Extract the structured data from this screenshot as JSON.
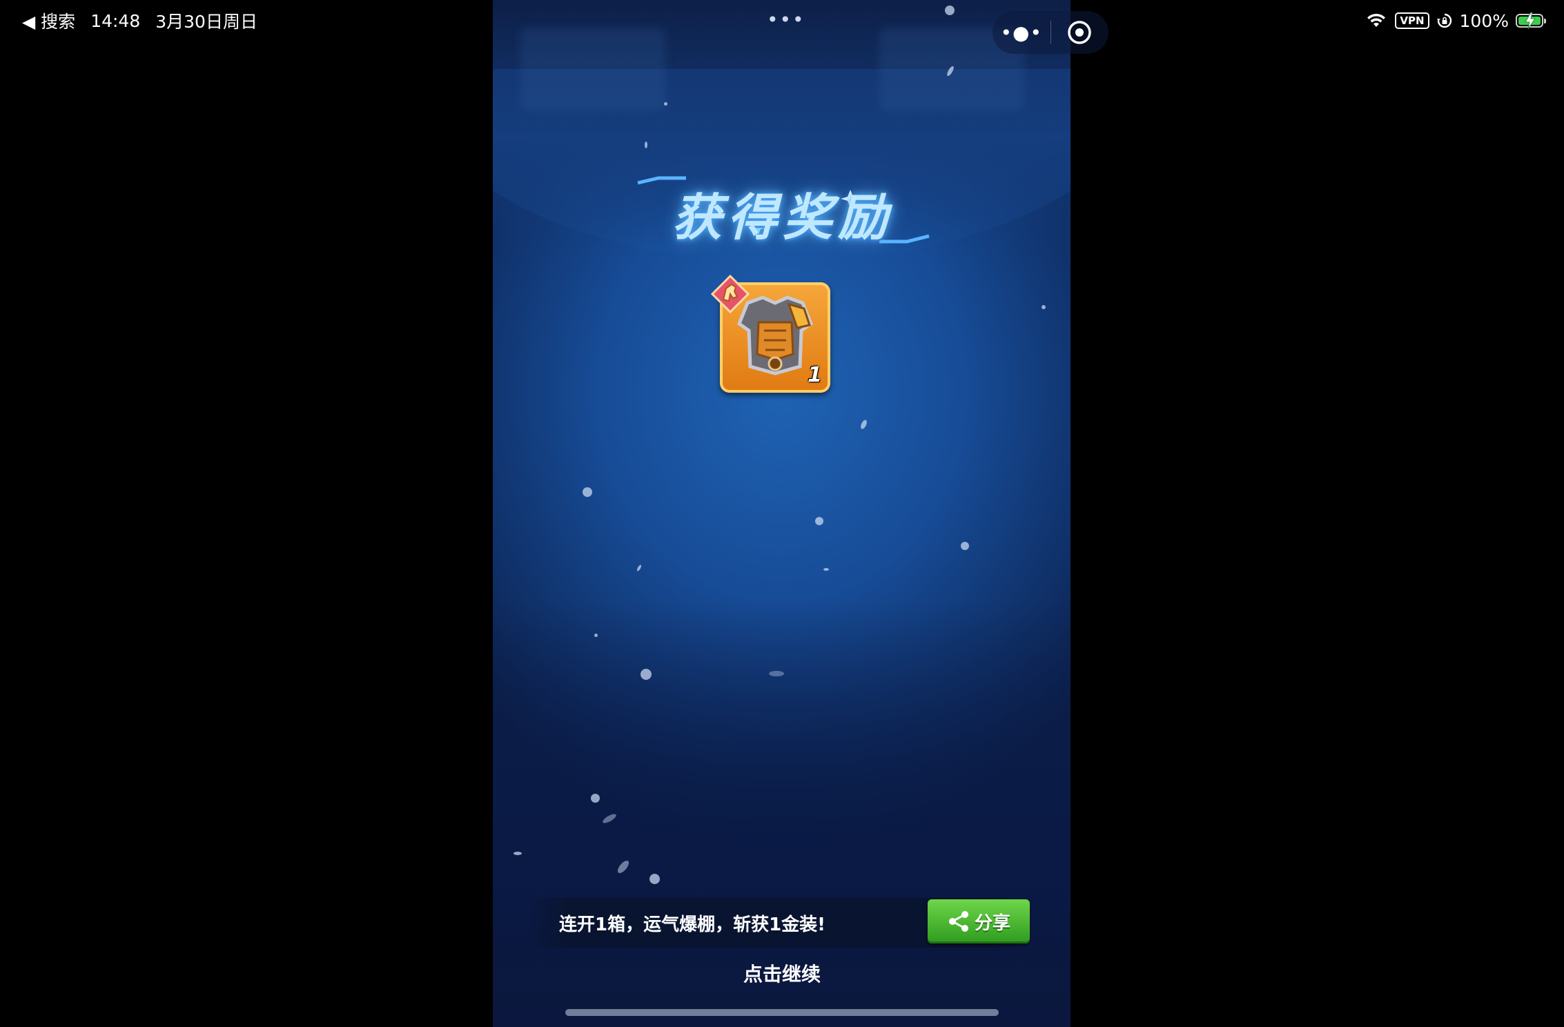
{
  "status_bar": {
    "back_label": "◀ 搜索",
    "time": "14:48",
    "date": "3月30日周日",
    "vpn": "VPN",
    "battery": "100%"
  },
  "top_dots": "•••",
  "capsule": {
    "more": "•●•"
  },
  "title": "获得奖励",
  "reward": {
    "item_icon": "armor-icon",
    "count": "1"
  },
  "share": {
    "text": "连开1箱，运气爆棚，斩获1金装!",
    "button_label": "分享"
  },
  "continue_label": "点击继续",
  "colors": {
    "share_green": "#3fae28",
    "reward_orange": "#f29a2e",
    "bg_blue": "#174c97"
  }
}
